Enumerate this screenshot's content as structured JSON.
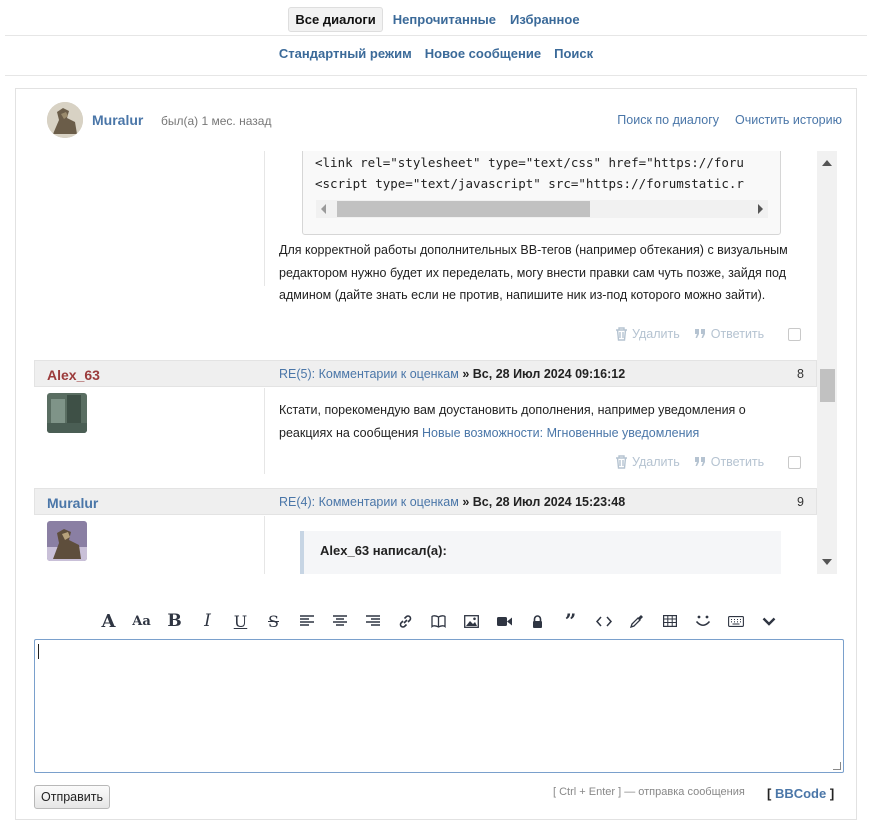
{
  "tabs": {
    "all": "Все диалоги",
    "unread": "Непрочитанные",
    "favorites": "Избранное"
  },
  "modes": {
    "standard": "Стандартный режим",
    "new_message": "Новое сообщение",
    "search": "Поиск"
  },
  "dialog": {
    "user": "Muralur",
    "status": "был(а) 1 мес. назад",
    "search_dialog": "Поиск по диалогу",
    "clear_history": "Очистить историю"
  },
  "code_lines": [
    "<link rel=\"stylesheet\" type=\"text/css\" href=\"https://foru",
    "<script type=\"text/javascript\" src=\"https://forumstatic.r"
  ],
  "message_prev": {
    "lines": [
      "Для корректной работы дополнительных BB-тегов (например обтекания) с визуальным",
      "редактором нужно будет их переделать, могу внести правки сам чуть позже, зайдя под",
      "админом (дайте знать если не против, напишите ник из-под которого можно зайти)."
    ]
  },
  "actions": {
    "delete": "Удалить",
    "reply": "Ответить"
  },
  "messages": [
    {
      "author": "Alex_63",
      "author_color": "#9b3b3b",
      "subject": "RE(5): Комментарии к оценкам",
      "date_sep": " » ",
      "date": "Вс, 28 Июл 2024 09:16:12",
      "number": "8",
      "text": "Кстати, порекомендую вам доустановить дополнения, например уведомления о",
      "text2": "реакциях на сообщения ",
      "link": "Новые возможности: Мгновенные уведомления"
    },
    {
      "author": "Muralur",
      "author_color": "#4a76a8",
      "subject": "RE(4): Комментарии к оценкам",
      "date_sep": " » ",
      "date": "Вс, 28 Июл 2024 15:23:48",
      "number": "9",
      "quote": "Alex_63 написал(а):"
    }
  ],
  "toolbar_icons": [
    "font-icon",
    "font-size-icon",
    "bold-icon",
    "italic-icon",
    "underline-icon",
    "strikethrough-icon",
    "align-left-icon",
    "align-center-icon",
    "align-right-icon",
    "link-icon",
    "book-icon",
    "image-icon",
    "video-icon",
    "lock-icon",
    "quote-icon",
    "code-icon",
    "color-picker-icon",
    "table-icon",
    "smile-icon",
    "keyboard-icon",
    "expand-icon"
  ],
  "editor": {
    "value": ""
  },
  "send_button": "Отправить",
  "hint": "[ Ctrl + Enter ] — отправка сообщения",
  "bbcode": {
    "open": "[ ",
    "label": "BBCode",
    "close": " ]"
  }
}
